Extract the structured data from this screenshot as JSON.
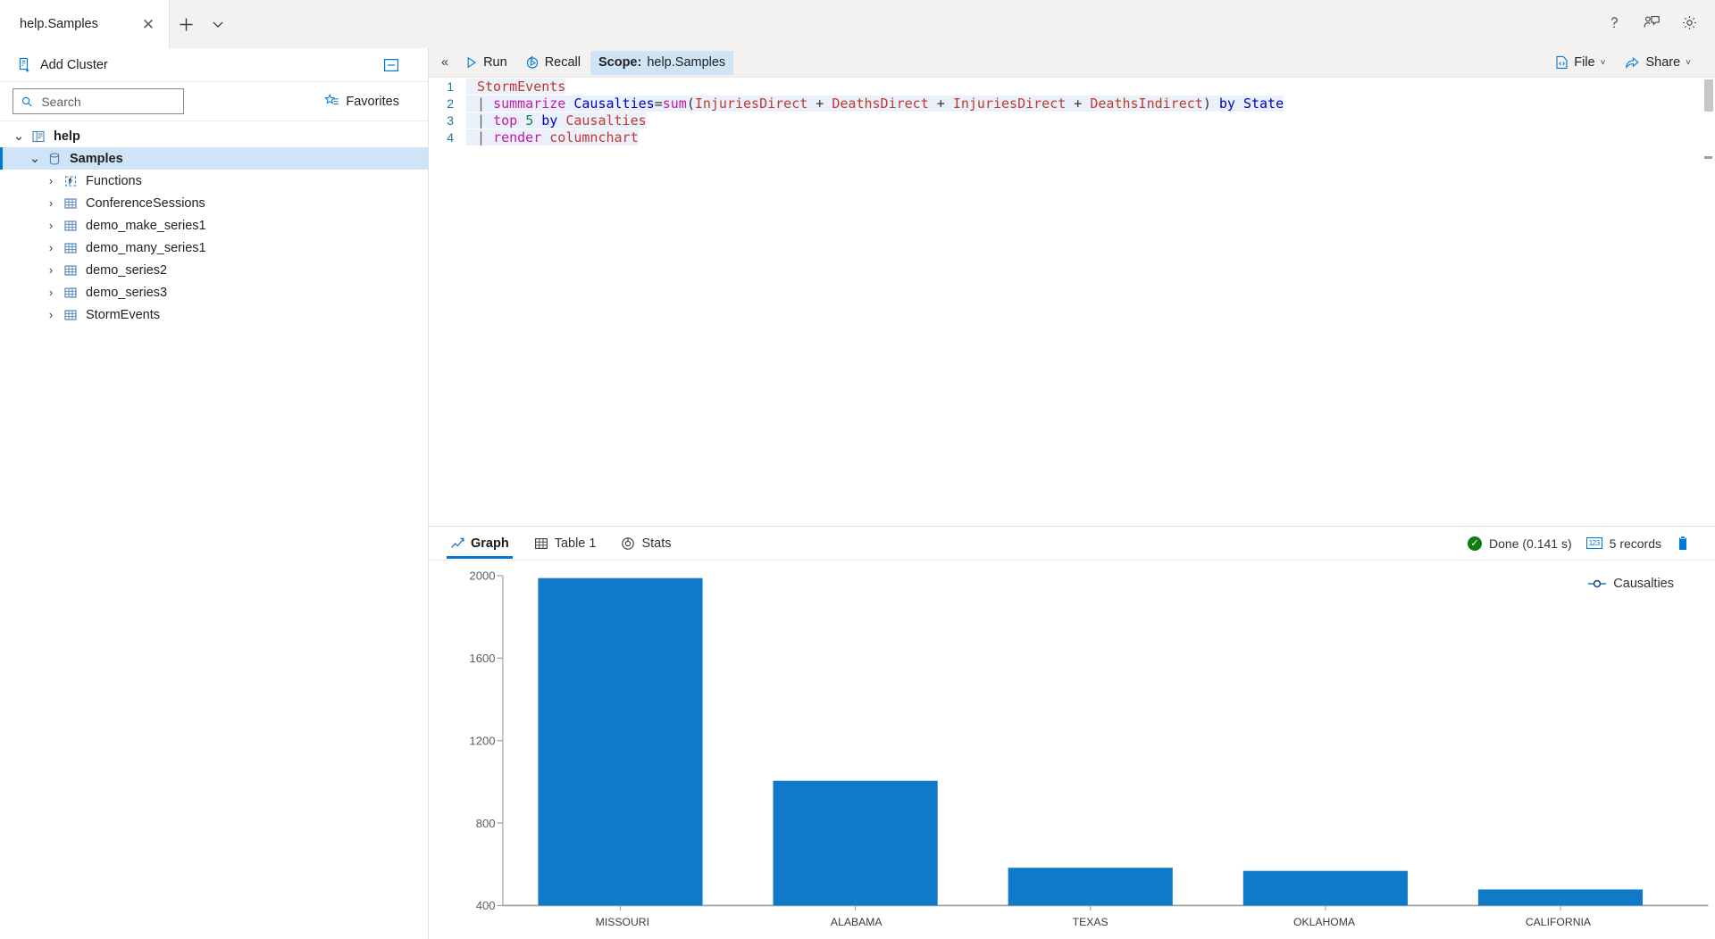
{
  "window": {
    "tab": {
      "title": "help.Samples",
      "close_label": "✕"
    },
    "new_tab_label": "+",
    "tab_menu_label": "˅",
    "header_icons": [
      {
        "name": "help-icon",
        "label": "?"
      },
      {
        "name": "feedback-icon",
        "label": "feedback"
      },
      {
        "name": "settings-gear-icon",
        "label": "settings"
      }
    ]
  },
  "sidebar": {
    "add_cluster_label": "Add Cluster",
    "collapse_panel_label": "collapse-panel",
    "search": {
      "placeholder": "Search",
      "value": ""
    },
    "favorites_label": "Favorites",
    "tree": [
      {
        "label": "help",
        "indent": 0,
        "icon": "cluster-icon",
        "chevron": "˅",
        "expanded": true,
        "selected": false,
        "bold": true
      },
      {
        "label": "Samples",
        "indent": 1,
        "icon": "database-icon",
        "chevron": "˅",
        "expanded": true,
        "selected": true,
        "bold": true
      },
      {
        "label": "Functions",
        "indent": 2,
        "icon": "function-icon",
        "chevron": "›",
        "expanded": false,
        "selected": false,
        "bold": false
      },
      {
        "label": "ConferenceSessions",
        "indent": 2,
        "icon": "table-icon",
        "chevron": "›",
        "expanded": false,
        "selected": false,
        "bold": false
      },
      {
        "label": "demo_make_series1",
        "indent": 2,
        "icon": "table-icon",
        "chevron": "›",
        "expanded": false,
        "selected": false,
        "bold": false
      },
      {
        "label": "demo_many_series1",
        "indent": 2,
        "icon": "table-icon",
        "chevron": "›",
        "expanded": false,
        "selected": false,
        "bold": false
      },
      {
        "label": "demo_series2",
        "indent": 2,
        "icon": "table-icon",
        "chevron": "›",
        "expanded": false,
        "selected": false,
        "bold": false
      },
      {
        "label": "demo_series3",
        "indent": 2,
        "icon": "table-icon",
        "chevron": "›",
        "expanded": false,
        "selected": false,
        "bold": false
      },
      {
        "label": "StormEvents",
        "indent": 2,
        "icon": "table-icon",
        "chevron": "›",
        "expanded": false,
        "selected": false,
        "bold": false
      }
    ]
  },
  "toolbar": {
    "collapse_label": "«",
    "run_label": "Run",
    "recall_label": "Recall",
    "scope_prefix": "Scope:",
    "scope_value": "help.Samples",
    "file_label": "File",
    "share_label": "Share",
    "caret": "˅"
  },
  "editor": {
    "lines": [
      {
        "no": "1",
        "segments": [
          {
            "t": "StormEvents",
            "c": "k-table"
          }
        ]
      },
      {
        "no": "2",
        "segments": [
          {
            "t": "| ",
            "c": "k-pipe"
          },
          {
            "t": "summarize",
            "c": "k-op"
          },
          {
            "t": " ",
            "c": "k-plain"
          },
          {
            "t": "Causalties",
            "c": "k-ident"
          },
          {
            "t": "=",
            "c": "k-plain"
          },
          {
            "t": "sum",
            "c": "k-fn"
          },
          {
            "t": "(",
            "c": "k-plain"
          },
          {
            "t": "InjuriesDirect",
            "c": "k-col"
          },
          {
            "t": " + ",
            "c": "k-plain"
          },
          {
            "t": "DeathsDirect",
            "c": "k-col"
          },
          {
            "t": " + ",
            "c": "k-plain"
          },
          {
            "t": "InjuriesDirect",
            "c": "k-col"
          },
          {
            "t": " + ",
            "c": "k-plain"
          },
          {
            "t": "DeathsIndirect",
            "c": "k-col"
          },
          {
            "t": ")",
            "c": "k-plain"
          },
          {
            "t": " by ",
            "c": "k-kw"
          },
          {
            "t": "State",
            "c": "k-ident"
          }
        ]
      },
      {
        "no": "3",
        "segments": [
          {
            "t": "| ",
            "c": "k-pipe"
          },
          {
            "t": "top",
            "c": "k-op"
          },
          {
            "t": " ",
            "c": "k-plain"
          },
          {
            "t": "5",
            "c": "k-num"
          },
          {
            "t": " by ",
            "c": "k-kw"
          },
          {
            "t": "Causalties",
            "c": "k-col"
          }
        ]
      },
      {
        "no": "4",
        "segments": [
          {
            "t": "| ",
            "c": "k-pipe"
          },
          {
            "t": "render",
            "c": "k-op"
          },
          {
            "t": " ",
            "c": "k-plain"
          },
          {
            "t": "columnchart",
            "c": "k-col"
          }
        ]
      }
    ]
  },
  "results": {
    "tabs": [
      {
        "label": "Graph",
        "icon": "line-chart-icon",
        "active": true
      },
      {
        "label": "Table 1",
        "icon": "table-icon",
        "active": false
      },
      {
        "label": "Stats",
        "icon": "stats-icon",
        "active": false
      }
    ],
    "status_text": "Done (0.141 s)",
    "records_text": "5 records",
    "copy_label": "copy-to-clipboard"
  },
  "chart_data": {
    "type": "bar",
    "title": "",
    "categories": [
      "MISSOURI",
      "ALABAMA",
      "TEXAS",
      "OKLAHOMA",
      "CALIFORNIA"
    ],
    "values": [
      1988,
      1005,
      583,
      568,
      478
    ],
    "series": [
      {
        "name": "Causalties",
        "values": [
          1988,
          1005,
          583,
          568,
          478
        ],
        "color": "#107ac9"
      }
    ],
    "legend": [
      "Causalties"
    ],
    "legend_position": "top-right",
    "xlabel": "",
    "ylabel": "",
    "ylim": [
      400,
      2000
    ],
    "yticks": [
      400,
      800,
      1200,
      1600,
      2000
    ],
    "grid": false,
    "bar_color": "#107ac9"
  }
}
